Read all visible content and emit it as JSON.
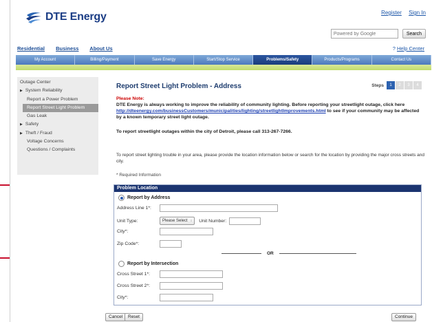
{
  "brand": {
    "name": "DTE Energy"
  },
  "top_links": [
    "Register",
    "Sign In"
  ],
  "search": {
    "placeholder": "Powered by Google",
    "button": "Search"
  },
  "audience_links": [
    "Residential",
    "Business",
    "About Us"
  ],
  "help": {
    "mark": "?",
    "label": "Help Center"
  },
  "nav_tabs": [
    "My Account",
    "Billing/Payment",
    "Save Energy",
    "Start/Stop Service",
    "Problems/Safety",
    "Products/Programs",
    "Contact Us"
  ],
  "active_tab": "Problems/Safety",
  "sidebar": [
    {
      "label": "Outage Center",
      "type": "plain"
    },
    {
      "label": "System Reliability",
      "type": "arrow"
    },
    {
      "label": "Report a Power Problem",
      "type": "plain"
    },
    {
      "label": "Report Street Light Problem",
      "type": "active"
    },
    {
      "label": "Gas Leak",
      "type": "plain"
    },
    {
      "label": "Safety",
      "type": "arrow"
    },
    {
      "label": "Theft / Fraud",
      "type": "arrow"
    },
    {
      "label": "Voltage Concerns",
      "type": "plain"
    },
    {
      "label": "Questions / Complaints",
      "type": "plain"
    }
  ],
  "page": {
    "title": "Report Street Light Problem - Address",
    "steps_label": "Steps",
    "steps": [
      "1",
      "2",
      "3",
      "4"
    ],
    "active_step": "1",
    "note_label": "Please Note:",
    "note_text_1": "DTE Energy is always working to improve the reliability of community lighting. Before reporting your streetlight outage, click here",
    "note_link": "http://dteenergy.com/businessCustomers/municipalities/lighting/streetlightImprovements.html",
    "note_text_2": "to see if your community may be affected by a known temporary street light outage.",
    "detroit_text": "To report streetlight outages within the city of Detroit, please call 313-267-7266.",
    "instructions": "To report street lighting trouble in your area, please provide the location information below or search for the location by providing the major cross streets and city.",
    "required": "* Required Information"
  },
  "form": {
    "heading": "Problem Location",
    "by_address": "Report by Address",
    "address_line_label": "Address Line 1*:",
    "unit_type_label": "Unit Type:",
    "unit_type_value": "Please Select",
    "unit_number_label": "Unit Number:",
    "city_label": "City*:",
    "zip_label": "Zip Code*:",
    "or_label": "OR",
    "by_intersection": "Report by Intersection",
    "cross1_label": "Cross Street 1*:",
    "cross2_label": "Cross Street 2*:",
    "city2_label": "City*:",
    "cancel": "Cancel",
    "reset": "Reset",
    "continue": "Continue"
  },
  "colors": {
    "brand_blue": "#1b3d85",
    "nav_active": "#1a3d7c",
    "panel_head": "#1b3470",
    "annotation_red": "#c8102e",
    "note_red": "#cc0000"
  }
}
